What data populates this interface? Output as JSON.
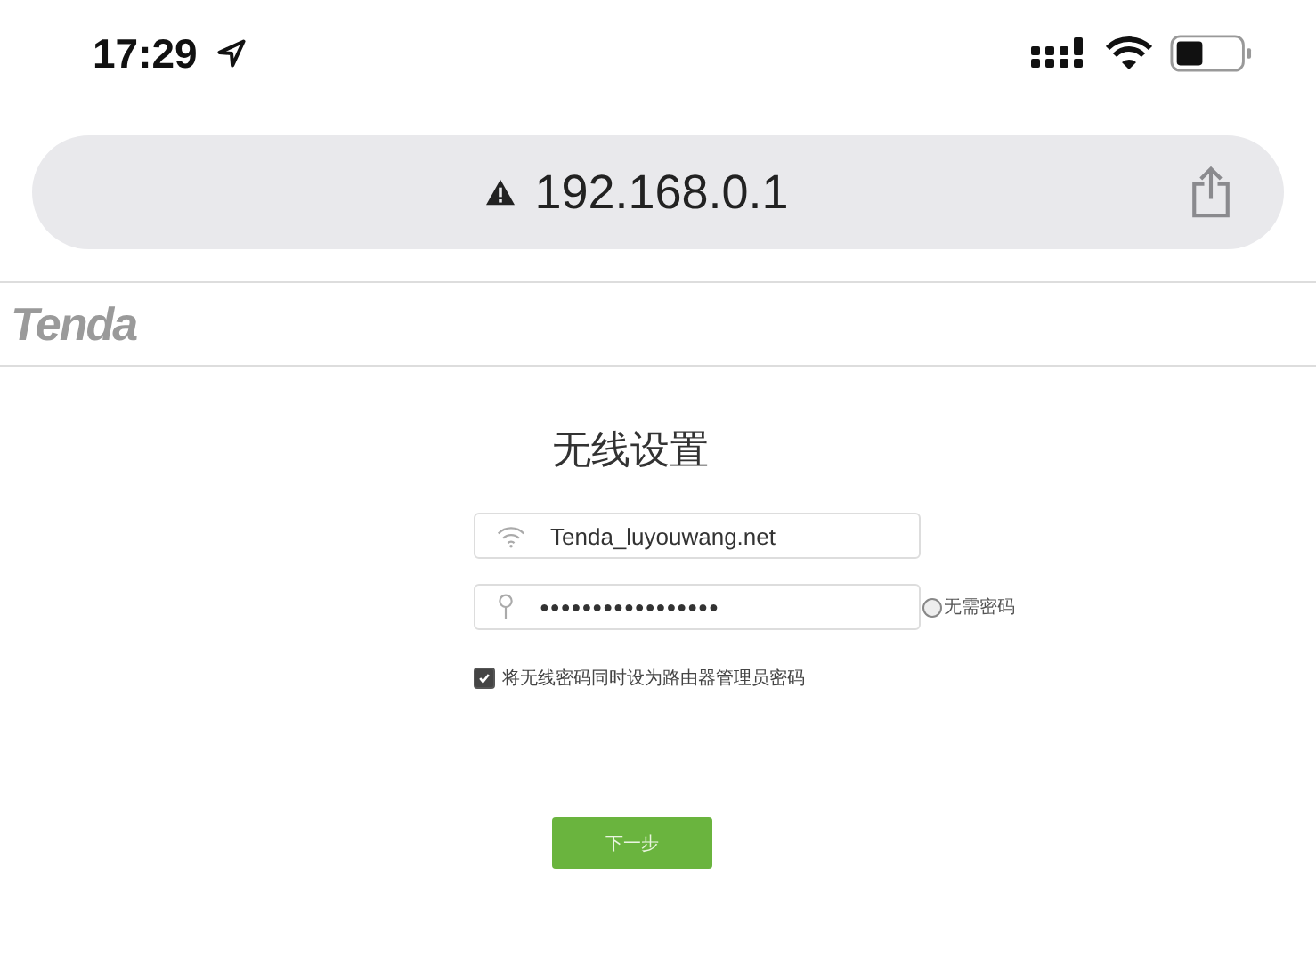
{
  "status_bar": {
    "time": "17:29"
  },
  "browser": {
    "url": "192.168.0.1"
  },
  "header": {
    "logo": "Tenda"
  },
  "title": "无线设置",
  "fields": [
    {
      "kind": "wifi",
      "value": "Tenda_luyouwang.net"
    },
    {
      "kind": "password",
      "value": "●●●●●●●●●●●●●●●●●",
      "option": {
        "label": "无需密码",
        "checked": false
      }
    }
  ],
  "checkbox": {
    "label": "将无线密码同时设为路由器管理员密码",
    "checked": true
  },
  "button": "下一步"
}
